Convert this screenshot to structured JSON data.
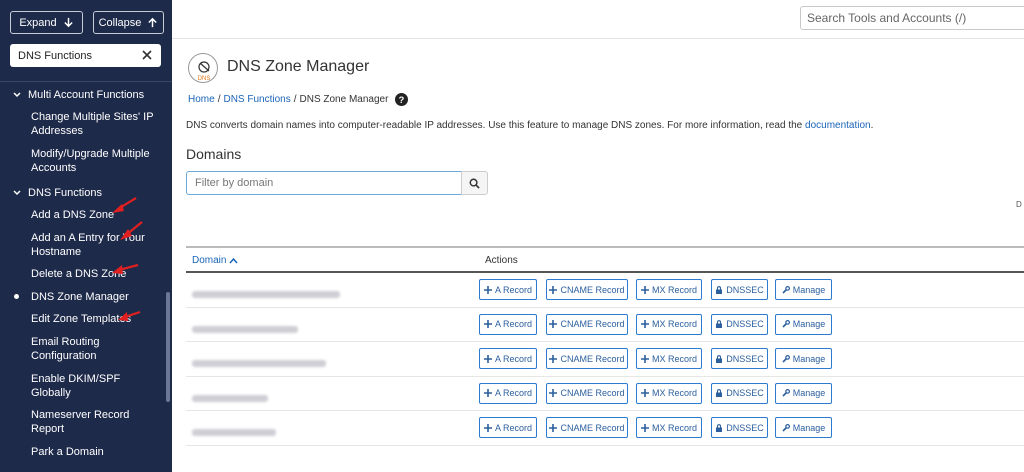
{
  "sidebar": {
    "expand_label": "Expand",
    "collapse_label": "Collapse",
    "search_value": "DNS Functions",
    "groups": [
      {
        "label": "Multi Account Functions"
      },
      {
        "label": "DNS Functions"
      }
    ],
    "items": [
      {
        "label": "Change Multiple Sites' IP Addresses"
      },
      {
        "label": "Modify/Upgrade Multiple Accounts"
      },
      {
        "label": "Add a DNS Zone"
      },
      {
        "label": "Add an A Entry for Your Hostname"
      },
      {
        "label": "Delete a DNS Zone"
      },
      {
        "label": "DNS Zone Manager"
      },
      {
        "label": "Edit Zone Templates"
      },
      {
        "label": "Email Routing Configuration"
      },
      {
        "label": "Enable DKIM/SPF Globally"
      },
      {
        "label": "Nameserver Record Report"
      },
      {
        "label": "Park a Domain"
      }
    ]
  },
  "header": {
    "search_placeholder": "Search Tools and Accounts (/)"
  },
  "page": {
    "title": "DNS Zone Manager",
    "logo_text": "DNS",
    "breadcrumb": [
      "Home",
      "/",
      "DNS Functions",
      "/",
      "DNS Zone Manager"
    ],
    "description": "DNS converts domain names into computer-readable IP addresses. Use this feature to manage DNS zones. For more information, read the ",
    "description_link": "documentation",
    "description_end": ".",
    "section_title": "Domains",
    "filter_placeholder": "Filter by domain",
    "right_label": "D"
  },
  "table": {
    "headers": {
      "domain": "Domain",
      "actions": "Actions"
    },
    "action_labels": [
      "A Record",
      "CNAME Record",
      "MX Record",
      "DNSSEC",
      "Manage"
    ]
  },
  "colors": {
    "sidebar": "#1e2a4a",
    "accent": "#1a65b8",
    "annotation_arrow": "#e02020"
  }
}
